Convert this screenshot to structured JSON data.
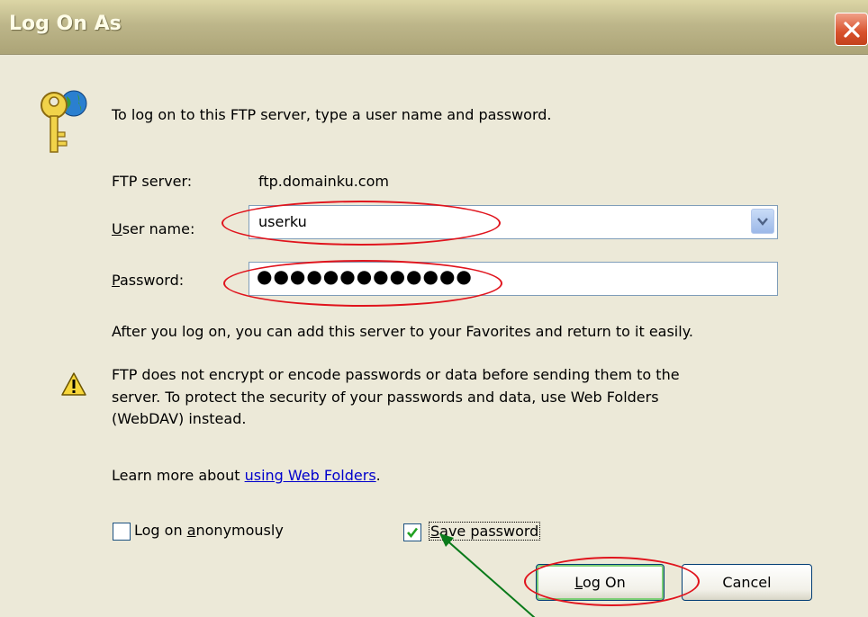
{
  "window": {
    "title": "Log On As",
    "close_label": "Close"
  },
  "intro": "To log on to this FTP server, type a user name and password.",
  "server": {
    "label": "FTP server:",
    "value": "ftp.domainku.com"
  },
  "username": {
    "label_accel": "U",
    "label_rest": "ser name:",
    "value": "userku"
  },
  "password": {
    "label_accel": "P",
    "label_rest": "assword:",
    "masked": "●●●●●●●●●●●●●"
  },
  "favorites_note": "After you log on, you can add this server to your Favorites and return to it easily.",
  "warning": {
    "line1": "FTP does not encrypt or encode passwords or data before sending them to the",
    "line2": "server.  To protect the security of your passwords and data, use Web Folders",
    "line3": "(WebDAV) instead."
  },
  "learn_more": {
    "prefix": "Learn more about ",
    "link": "using Web Folders",
    "suffix": "."
  },
  "anonymous": {
    "label_pre": "Log on ",
    "label_accel": "a",
    "label_post": "nonymously",
    "checked": false
  },
  "save_password": {
    "label_accel": "S",
    "label_rest": "ave password",
    "checked": true
  },
  "buttons": {
    "logon_accel": "L",
    "logon_rest": "og On",
    "cancel": "Cancel"
  },
  "colors": {
    "annotation_ellipse": "#e0141d",
    "annotation_arrow": "#0a7a1a",
    "checkmark": "#21a121"
  }
}
